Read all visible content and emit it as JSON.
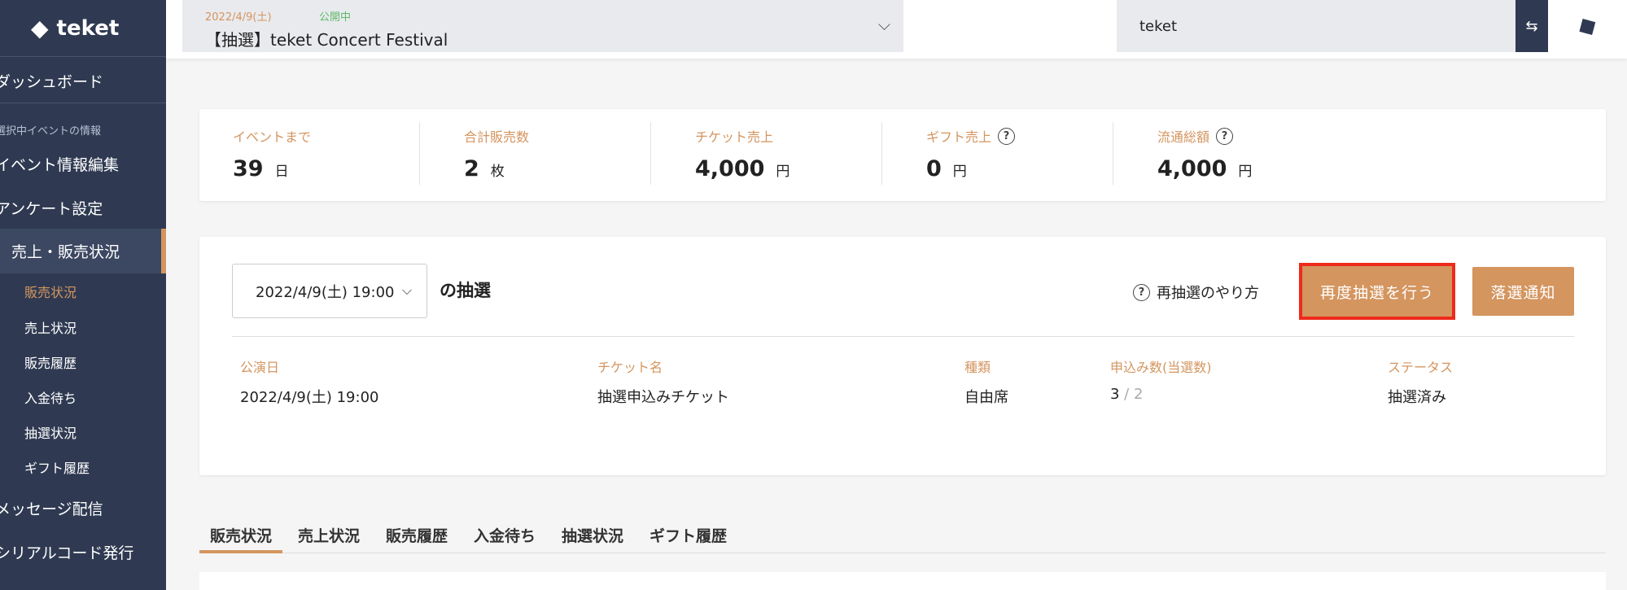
{
  "sidebar": {
    "logo": "teket",
    "dashboard": "ダッシュボード",
    "section_label": "選択中イベントの情報",
    "event_edit": "イベント情報編集",
    "survey": "アンケート設定",
    "sales_group": "売上・販売状況",
    "subitems": [
      "販売状況",
      "売上状況",
      "販売履歴",
      "入金待ち",
      "抽選状況",
      "ギフト履歴"
    ],
    "messages": "メッセージ配信",
    "serial": "シリアルコード発行"
  },
  "header": {
    "event_date": "2022/4/9(土)",
    "event_status": "公開中",
    "event_name": "【抽選】teket Concert Festival",
    "org_name": "teket"
  },
  "stats": [
    {
      "label": "イベントまで",
      "value": "39",
      "unit": "日",
      "help": false
    },
    {
      "label": "合計販売数",
      "value": "2",
      "unit": "枚",
      "help": false
    },
    {
      "label": "チケット売上",
      "value": "4,000",
      "unit": "円",
      "help": false
    },
    {
      "label": "ギフト売上",
      "value": "0",
      "unit": "円",
      "help": true
    },
    {
      "label": "流通総額",
      "value": "4,000",
      "unit": "円",
      "help": true
    }
  ],
  "lottery": {
    "selected_date": "2022/4/9(土) 19:00",
    "suffix": "の抽選",
    "howto": "再抽選のやり方",
    "redraw_button": "再度抽選を行う",
    "notify_button": "落選通知",
    "columns": [
      "公演日",
      "チケット名",
      "種類",
      "申込み数(当選数)",
      "ステータス"
    ],
    "row": {
      "date": "2022/4/9(土) 19:00",
      "ticket": "抽選申込みチケット",
      "type": "自由席",
      "applied": "3",
      "won": "2",
      "status": "抽選済み"
    }
  },
  "tabs": [
    "販売状況",
    "売上状況",
    "販売履歴",
    "入金待ち",
    "抽選状況",
    "ギフト履歴"
  ],
  "colors": {
    "accent": "#d4955f",
    "sidebar": "#2f3a52",
    "highlight": "#ee2a1b",
    "public": "#5fb86a"
  }
}
